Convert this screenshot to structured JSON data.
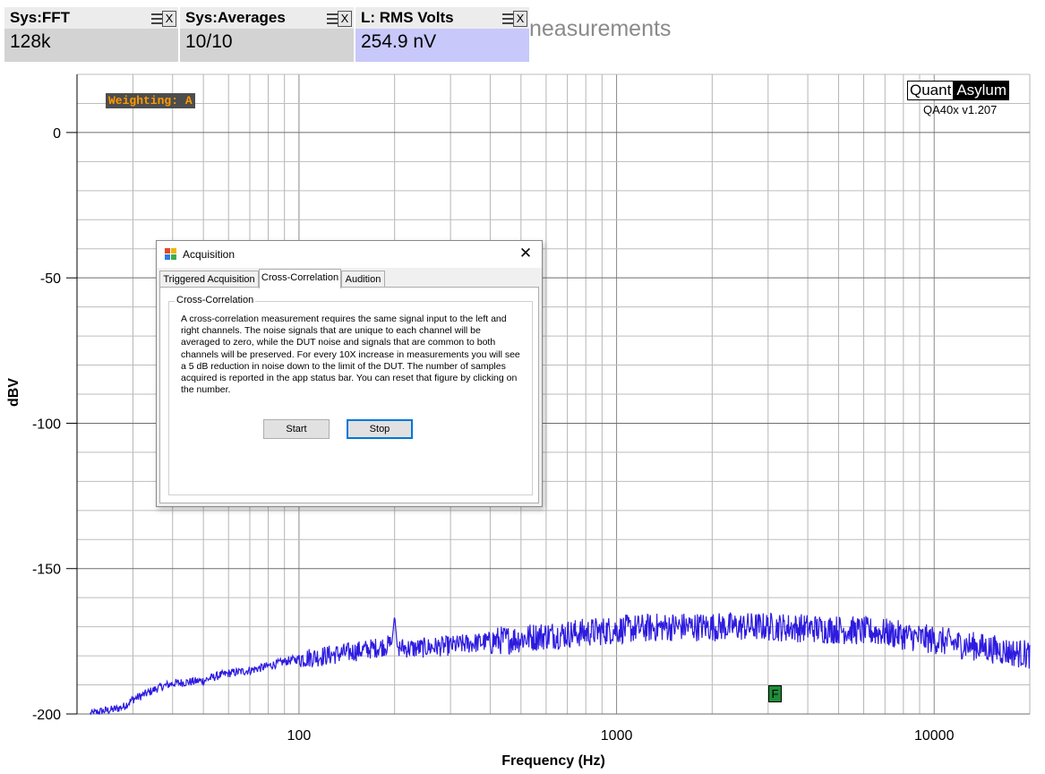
{
  "measurements": [
    {
      "title": "Sys:FFT",
      "value": "128k",
      "highlight": false
    },
    {
      "title": "Sys:Averages",
      "value": "10/10",
      "highlight": false
    },
    {
      "title": "L: RMS Volts",
      "value": "254.9 nV",
      "highlight": true
    }
  ],
  "widget_close_label": "X",
  "partial_text": "neasurements",
  "logo": {
    "left": "Quant",
    "right": "Asylum"
  },
  "version": "QA40x v1.207",
  "weighting": "Weighting: A",
  "marker_label": "F",
  "chart_data": {
    "type": "line",
    "xlabel": "Frequency (Hz)",
    "ylabel": "dBV",
    "x_scale": "log",
    "xlim": [
      20,
      20000
    ],
    "ylim": [
      -200,
      20
    ],
    "x_ticks": [
      "100",
      "1000",
      "10000"
    ],
    "y_ticks": [
      "0",
      "-50",
      "-100",
      "-150",
      "-200"
    ],
    "grid": true,
    "series": [
      {
        "color": "#2e1be0",
        "x": [
          22,
          24,
          26,
          28,
          30,
          33,
          36,
          40,
          45,
          50,
          55,
          60,
          70,
          80,
          90,
          100,
          120,
          140,
          160,
          180,
          196,
          200,
          204,
          230,
          260,
          300,
          400,
          500,
          600,
          800,
          1000,
          1200,
          1500,
          2000,
          2500,
          3000,
          4000,
          5000,
          6000,
          7000,
          8000,
          10000,
          12000,
          14000,
          16000,
          18000,
          20000
        ],
        "y": [
          -200,
          -199,
          -198.5,
          -197.5,
          -195,
          -193,
          -191,
          -189.5,
          -189,
          -188.5,
          -187,
          -186,
          -185,
          -183.5,
          -182,
          -181,
          -180,
          -179,
          -178,
          -177,
          -176,
          -166,
          -177,
          -177.5,
          -177,
          -176.5,
          -175,
          -174,
          -173,
          -172,
          -171,
          -170.5,
          -170,
          -170,
          -170,
          -170,
          -170.5,
          -171,
          -171.5,
          -172,
          -173,
          -174.5,
          -176,
          -177,
          -178,
          -179,
          -179.5
        ]
      }
    ]
  },
  "dialog": {
    "title": "Acquisition",
    "close_glyph": "✕",
    "tabs": [
      "Triggered Acquisition",
      "Cross-Correlation",
      "Audition"
    ],
    "active_tab": "Cross-Correlation",
    "group_title": "Cross-Correlation",
    "description": "A cross-correlation measurement requires the same signal input to the left and right channels. The noise signals that are unique to each channel will be averaged to zero, while the DUT noise and signals that are common to both channels will be preserved. For every 10X increase in measurements you will see a  5 dB reduction in noise down to the limit of the DUT. The number of samples acquired is reported in the app status bar. You can reset that figure by clicking on the number.",
    "start_label": "Start",
    "stop_label": "Stop"
  },
  "colors": {
    "trace": "#2e1be0",
    "highlight_bg": "#c8c8fa",
    "weighting_fg": "#ff9900",
    "marker_bg": "#1f8c38"
  },
  "icons": {
    "widget_menu": "hamburger-icon",
    "widget_close": "close-icon",
    "dialog_app": "app-icon",
    "dialog_close": "close-icon"
  }
}
